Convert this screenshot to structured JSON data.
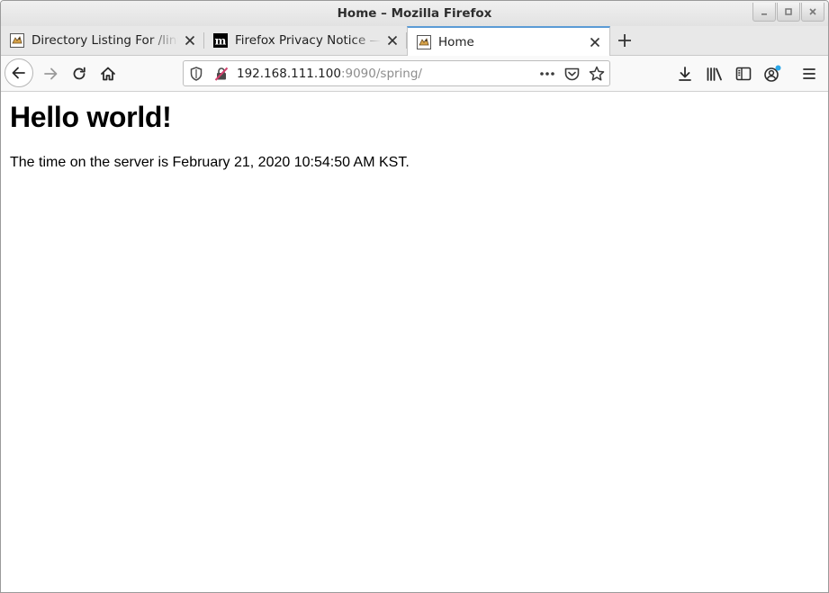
{
  "window": {
    "title": "Home – Mozilla Firefox"
  },
  "tabs": [
    {
      "label": "Directory Listing For /linux",
      "favicon": "tomcat-icon",
      "active": false
    },
    {
      "label": "Firefox Privacy Notice — Mozilla",
      "favicon": "mozilla-m-icon",
      "active": false
    },
    {
      "label": "Home",
      "favicon": "tomcat-icon",
      "active": true
    }
  ],
  "urlbar": {
    "host": "192.168.111.100",
    "rest": ":9090/spring/",
    "icons": [
      "shield-icon",
      "insecure-connection-icon",
      "more-actions-icon",
      "pocket-icon",
      "bookmark-star-icon"
    ]
  },
  "toolbar": {
    "icons": [
      "back-icon",
      "forward-icon",
      "reload-icon",
      "home-icon",
      "downloads-icon",
      "library-icon",
      "sidebar-icon",
      "account-icon",
      "menu-icon"
    ]
  },
  "page": {
    "heading": "Hello world!",
    "text": "The time on the server is February 21, 2020 10:54:50 AM KST."
  },
  "colors": {
    "active_tab_accent": "#5b9bd5",
    "insecure_icon": "#d2416e",
    "account_badge": "#2ba7e8"
  }
}
